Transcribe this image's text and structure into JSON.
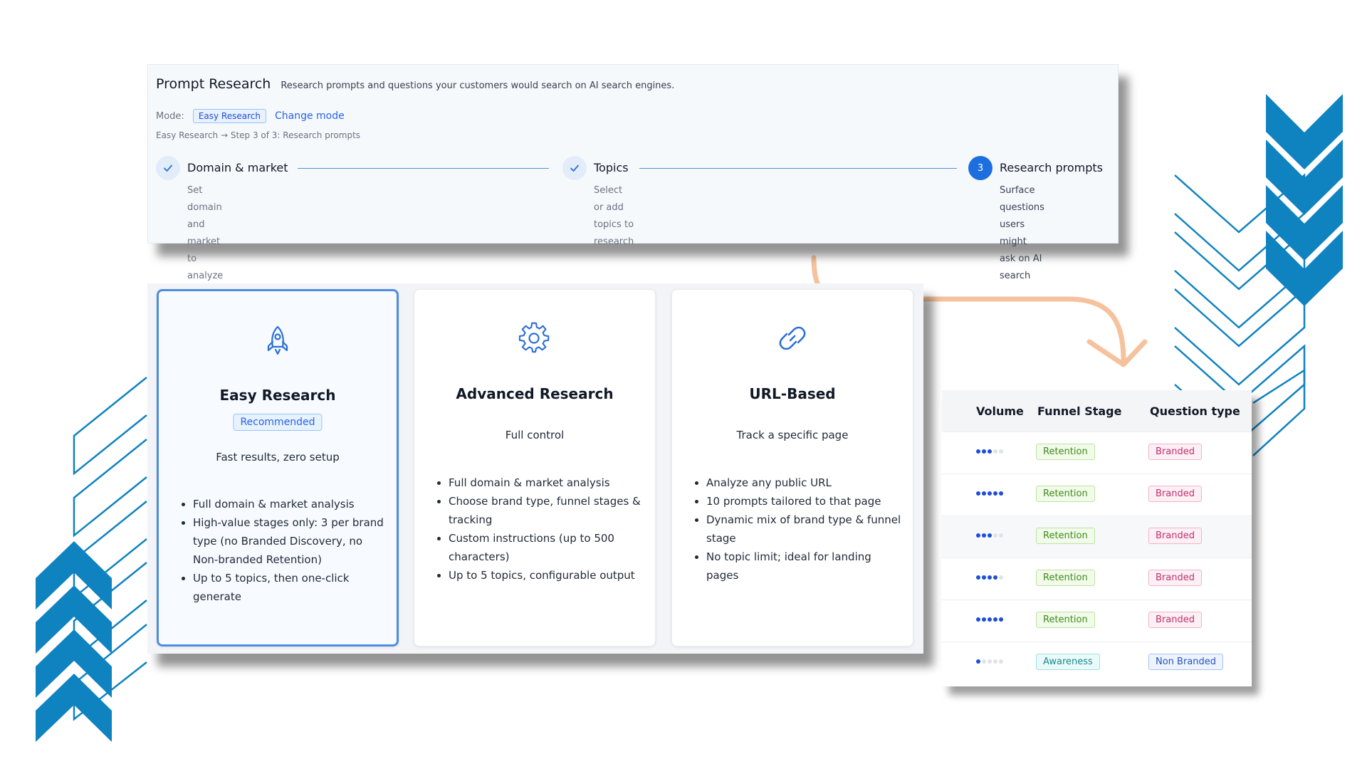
{
  "colors": {
    "accent": "#1d6fe0",
    "deco_blue": "#0f82c0",
    "arrow": "#f6c29e"
  },
  "header": {
    "title": "Prompt Research",
    "subtitle": "Research prompts and questions your customers would search on AI search engines.",
    "mode_label": "Mode:",
    "mode_value": "Easy Research",
    "change_mode": "Change mode",
    "breadcrumb": "Easy Research → Step 3 of 3: Research prompts"
  },
  "steps": [
    {
      "title": "Domain & market",
      "desc": [
        "Set domain and",
        "market to analyze"
      ],
      "status": "done",
      "icon": "check-icon"
    },
    {
      "title": "Topics",
      "desc": [
        "Select or add topics to",
        "research"
      ],
      "status": "done",
      "icon": "check-icon"
    },
    {
      "number": "3",
      "title": "Research prompts",
      "desc": [
        "Surface questions",
        "users might ask on AI",
        "search"
      ],
      "status": "current"
    }
  ],
  "cards": [
    {
      "icon": "rocket-icon",
      "title": "Easy Research",
      "badge": "Recommended",
      "tagline": "Fast results, zero setup",
      "features": [
        "Full domain & market analysis",
        "High-value stages only: 3 per brand type (no Branded Discovery, no Non-branded Retention)",
        "Up to 5 topics, then one-click generate"
      ],
      "selected": true
    },
    {
      "icon": "gear-icon",
      "title": "Advanced Research",
      "tagline": "Full control",
      "features": [
        "Full domain & market analysis",
        "Choose brand type, funnel stages & tracking",
        "Custom instructions (up to 500 characters)",
        "Up to 5 topics, configurable output"
      ]
    },
    {
      "icon": "link-icon",
      "title": "URL-Based",
      "tagline": "Track a specific page",
      "features": [
        "Analyze any public URL",
        "10 prompts tailored to that page",
        "Dynamic mix of brand type & funnel stage",
        "No topic limit; ideal for landing pages"
      ]
    }
  ],
  "table": {
    "columns": [
      "Volume",
      "Funnel Stage",
      "Question type"
    ],
    "rows": [
      {
        "volume": 3,
        "funnel_stage": "Retention",
        "question_type": "Branded"
      },
      {
        "volume": 5,
        "funnel_stage": "Retention",
        "question_type": "Branded"
      },
      {
        "volume": 3,
        "funnel_stage": "Retention",
        "question_type": "Branded"
      },
      {
        "volume": 4,
        "funnel_stage": "Retention",
        "question_type": "Branded"
      },
      {
        "volume": 5,
        "funnel_stage": "Retention",
        "question_type": "Branded"
      },
      {
        "volume": 1,
        "funnel_stage": "Awareness",
        "question_type": "Non Branded"
      }
    ],
    "volume_max": 5
  }
}
